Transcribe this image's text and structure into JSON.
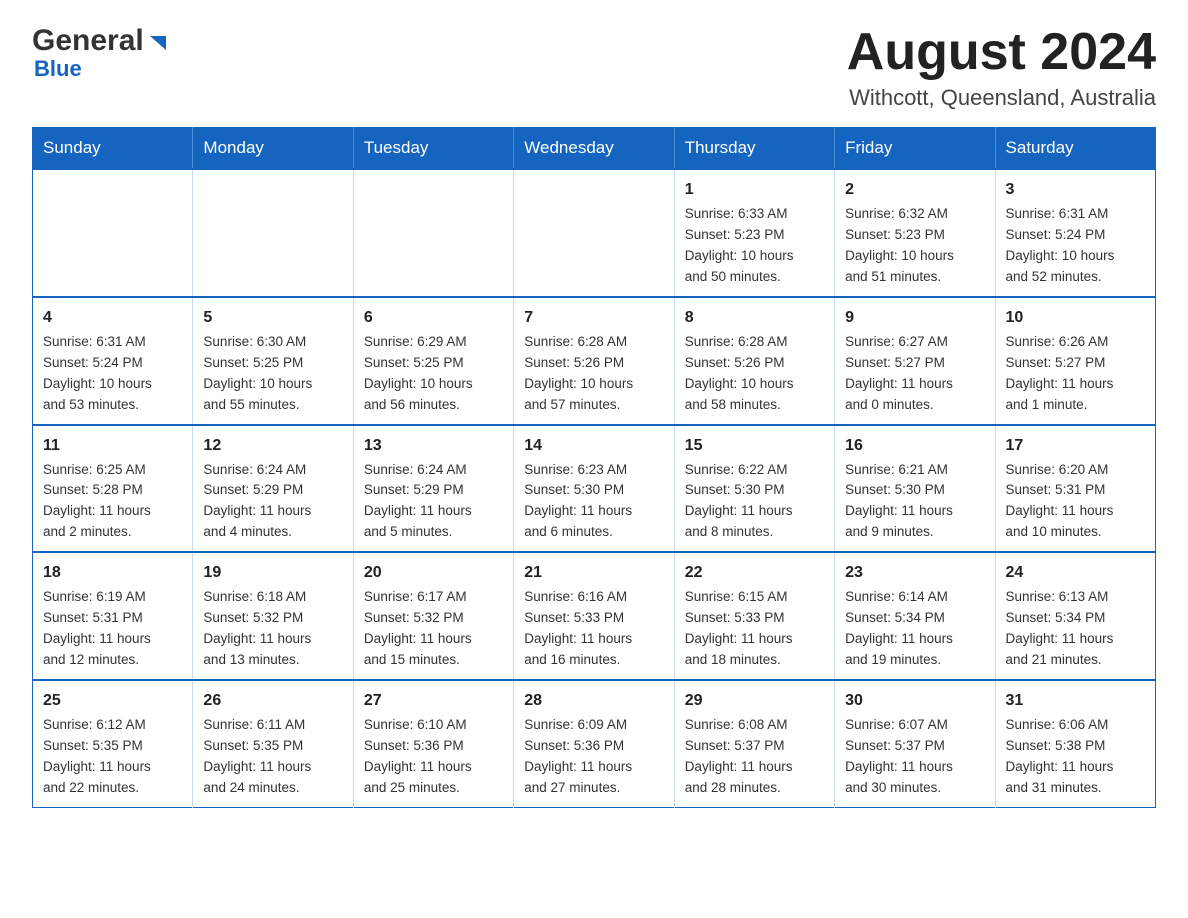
{
  "header": {
    "logo_general": "General",
    "logo_blue": "Blue",
    "month_title": "August 2024",
    "location": "Withcott, Queensland, Australia"
  },
  "days_of_week": [
    "Sunday",
    "Monday",
    "Tuesday",
    "Wednesday",
    "Thursday",
    "Friday",
    "Saturday"
  ],
  "weeks": [
    [
      {
        "day": "",
        "info": ""
      },
      {
        "day": "",
        "info": ""
      },
      {
        "day": "",
        "info": ""
      },
      {
        "day": "",
        "info": ""
      },
      {
        "day": "1",
        "info": "Sunrise: 6:33 AM\nSunset: 5:23 PM\nDaylight: 10 hours\nand 50 minutes."
      },
      {
        "day": "2",
        "info": "Sunrise: 6:32 AM\nSunset: 5:23 PM\nDaylight: 10 hours\nand 51 minutes."
      },
      {
        "day": "3",
        "info": "Sunrise: 6:31 AM\nSunset: 5:24 PM\nDaylight: 10 hours\nand 52 minutes."
      }
    ],
    [
      {
        "day": "4",
        "info": "Sunrise: 6:31 AM\nSunset: 5:24 PM\nDaylight: 10 hours\nand 53 minutes."
      },
      {
        "day": "5",
        "info": "Sunrise: 6:30 AM\nSunset: 5:25 PM\nDaylight: 10 hours\nand 55 minutes."
      },
      {
        "day": "6",
        "info": "Sunrise: 6:29 AM\nSunset: 5:25 PM\nDaylight: 10 hours\nand 56 minutes."
      },
      {
        "day": "7",
        "info": "Sunrise: 6:28 AM\nSunset: 5:26 PM\nDaylight: 10 hours\nand 57 minutes."
      },
      {
        "day": "8",
        "info": "Sunrise: 6:28 AM\nSunset: 5:26 PM\nDaylight: 10 hours\nand 58 minutes."
      },
      {
        "day": "9",
        "info": "Sunrise: 6:27 AM\nSunset: 5:27 PM\nDaylight: 11 hours\nand 0 minutes."
      },
      {
        "day": "10",
        "info": "Sunrise: 6:26 AM\nSunset: 5:27 PM\nDaylight: 11 hours\nand 1 minute."
      }
    ],
    [
      {
        "day": "11",
        "info": "Sunrise: 6:25 AM\nSunset: 5:28 PM\nDaylight: 11 hours\nand 2 minutes."
      },
      {
        "day": "12",
        "info": "Sunrise: 6:24 AM\nSunset: 5:29 PM\nDaylight: 11 hours\nand 4 minutes."
      },
      {
        "day": "13",
        "info": "Sunrise: 6:24 AM\nSunset: 5:29 PM\nDaylight: 11 hours\nand 5 minutes."
      },
      {
        "day": "14",
        "info": "Sunrise: 6:23 AM\nSunset: 5:30 PM\nDaylight: 11 hours\nand 6 minutes."
      },
      {
        "day": "15",
        "info": "Sunrise: 6:22 AM\nSunset: 5:30 PM\nDaylight: 11 hours\nand 8 minutes."
      },
      {
        "day": "16",
        "info": "Sunrise: 6:21 AM\nSunset: 5:30 PM\nDaylight: 11 hours\nand 9 minutes."
      },
      {
        "day": "17",
        "info": "Sunrise: 6:20 AM\nSunset: 5:31 PM\nDaylight: 11 hours\nand 10 minutes."
      }
    ],
    [
      {
        "day": "18",
        "info": "Sunrise: 6:19 AM\nSunset: 5:31 PM\nDaylight: 11 hours\nand 12 minutes."
      },
      {
        "day": "19",
        "info": "Sunrise: 6:18 AM\nSunset: 5:32 PM\nDaylight: 11 hours\nand 13 minutes."
      },
      {
        "day": "20",
        "info": "Sunrise: 6:17 AM\nSunset: 5:32 PM\nDaylight: 11 hours\nand 15 minutes."
      },
      {
        "day": "21",
        "info": "Sunrise: 6:16 AM\nSunset: 5:33 PM\nDaylight: 11 hours\nand 16 minutes."
      },
      {
        "day": "22",
        "info": "Sunrise: 6:15 AM\nSunset: 5:33 PM\nDaylight: 11 hours\nand 18 minutes."
      },
      {
        "day": "23",
        "info": "Sunrise: 6:14 AM\nSunset: 5:34 PM\nDaylight: 11 hours\nand 19 minutes."
      },
      {
        "day": "24",
        "info": "Sunrise: 6:13 AM\nSunset: 5:34 PM\nDaylight: 11 hours\nand 21 minutes."
      }
    ],
    [
      {
        "day": "25",
        "info": "Sunrise: 6:12 AM\nSunset: 5:35 PM\nDaylight: 11 hours\nand 22 minutes."
      },
      {
        "day": "26",
        "info": "Sunrise: 6:11 AM\nSunset: 5:35 PM\nDaylight: 11 hours\nand 24 minutes."
      },
      {
        "day": "27",
        "info": "Sunrise: 6:10 AM\nSunset: 5:36 PM\nDaylight: 11 hours\nand 25 minutes."
      },
      {
        "day": "28",
        "info": "Sunrise: 6:09 AM\nSunset: 5:36 PM\nDaylight: 11 hours\nand 27 minutes."
      },
      {
        "day": "29",
        "info": "Sunrise: 6:08 AM\nSunset: 5:37 PM\nDaylight: 11 hours\nand 28 minutes."
      },
      {
        "day": "30",
        "info": "Sunrise: 6:07 AM\nSunset: 5:37 PM\nDaylight: 11 hours\nand 30 minutes."
      },
      {
        "day": "31",
        "info": "Sunrise: 6:06 AM\nSunset: 5:38 PM\nDaylight: 11 hours\nand 31 minutes."
      }
    ]
  ]
}
